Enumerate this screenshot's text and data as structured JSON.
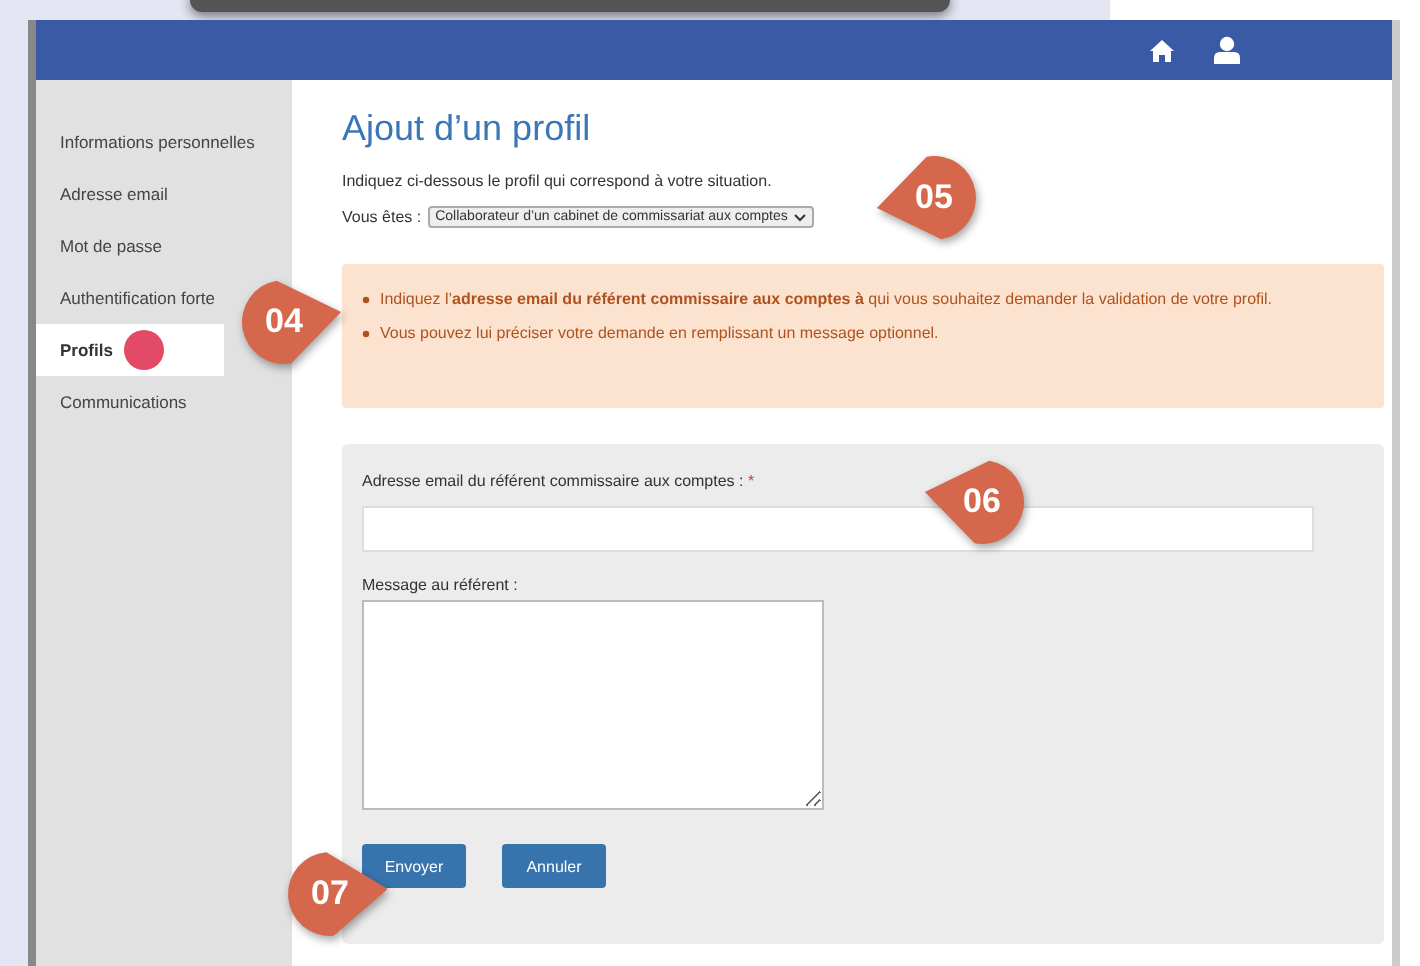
{
  "sidebar": {
    "items": [
      {
        "label": "Informations personnelles",
        "selected": false
      },
      {
        "label": "Adresse email",
        "selected": false
      },
      {
        "label": "Mot de passe",
        "selected": false
      },
      {
        "label": "Authentification forte",
        "selected": false
      },
      {
        "label": "Profils",
        "selected": true
      },
      {
        "label": "Communications",
        "selected": false
      }
    ]
  },
  "page": {
    "title": "Ajout d’un profil",
    "intro": "Indiquez ci-dessous le profil qui correspond à votre situation.",
    "select_label": "Vous êtes :",
    "select_value": "Collaborateur d’un cabinet de commissariat aux comptes"
  },
  "alert": {
    "items": [
      "Indiquez l’**adresse email du référent commissaire aux comptes à** qui vous souhaitez demander la validation de votre profil.",
      "Vous pouvez lui préciser votre demande en remplissant un message optionnel."
    ]
  },
  "form": {
    "email_label": "Adresse email du référent commissaire aux comptes :",
    "required_mark": "*",
    "message_label": "Message au référent :",
    "buttons": [
      "Envoyer",
      "Annuler"
    ]
  },
  "callouts": [
    "04",
    "05",
    "06",
    "07"
  ]
}
